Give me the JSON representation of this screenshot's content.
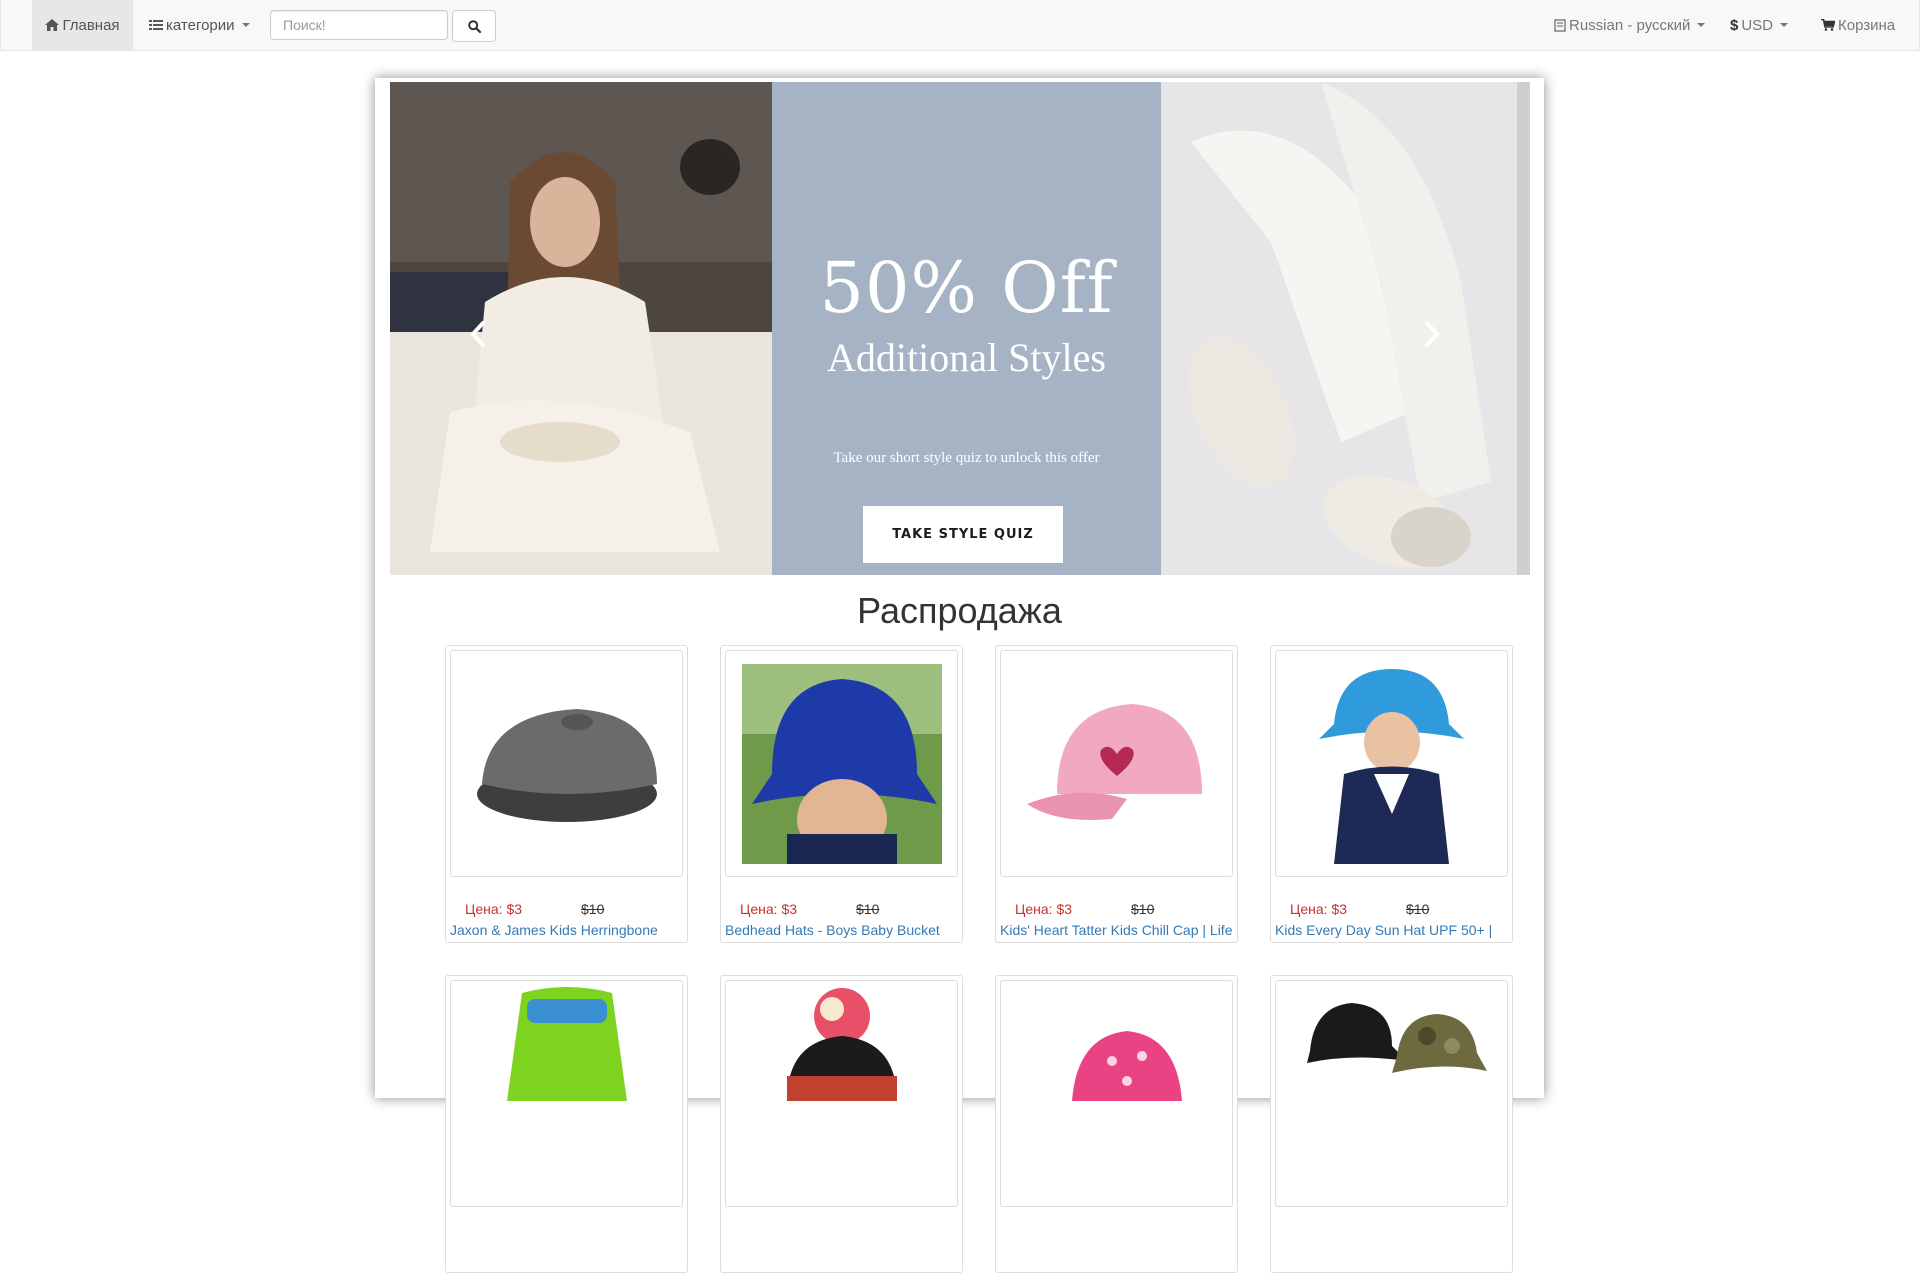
{
  "nav": {
    "home_label": "Главная",
    "categories_label": "категории",
    "search_placeholder": "Поиск!",
    "language_label": "Russian - русский",
    "currency_label": "USD",
    "cart_label": "Корзина"
  },
  "carousel": {
    "promo_title": "50% Off",
    "promo_subtitle": "Additional Styles",
    "promo_text": "Take our short style quiz to unlock this offer",
    "promo_button": "TAKE STYLE QUIZ"
  },
  "sale": {
    "title": "Распродажа",
    "products": [
      {
        "price": "Цена: $3",
        "old_price": "$10",
        "name": "Jaxon & James Kids Herringbone"
      },
      {
        "price": "Цена: $3",
        "old_price": "$10",
        "name": "Bedhead Hats - Boys Baby Bucket"
      },
      {
        "price": "Цена: $3",
        "old_price": "$10",
        "name": "Kids' Heart Tatter Kids Chill Cap | Life"
      },
      {
        "price": "Цена: $3",
        "old_price": "$10",
        "name": "Kids Every Day Sun Hat UPF 50+ |"
      }
    ]
  },
  "colors": {
    "navbar_bg": "#f8f8f8",
    "link": "#337ab7",
    "sale_price": "#c9302c",
    "promo_panel": "#a5b3c5"
  }
}
